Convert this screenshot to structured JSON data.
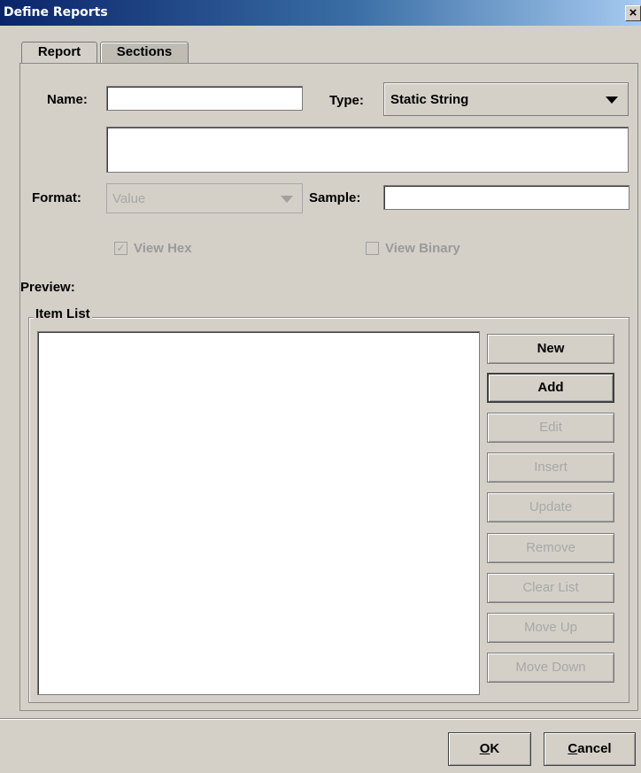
{
  "window": {
    "title": "Define Reports",
    "close_glyph": "×"
  },
  "tabs": [
    {
      "label": "Report",
      "active": true
    },
    {
      "label": "Sections",
      "active": false
    }
  ],
  "form": {
    "name_label": "Name:",
    "name_value": "",
    "type_label": "Type:",
    "type_value": "Static String",
    "text_value": "",
    "format_label": "Format:",
    "format_value": "Value",
    "sample_label": "Sample:",
    "sample_value": "",
    "view_hex_label": "View Hex",
    "view_hex_checked": true,
    "view_binary_label": "View Binary",
    "view_binary_checked": false,
    "preview_label": "Preview:"
  },
  "item_list": {
    "title": "Item List",
    "items": [],
    "buttons": [
      {
        "label": "New",
        "enabled": true
      },
      {
        "label": "Add",
        "enabled": true
      },
      {
        "label": "Edit",
        "enabled": false
      },
      {
        "label": "Insert",
        "enabled": false
      },
      {
        "label": "Update",
        "enabled": false
      },
      {
        "label": "Remove",
        "enabled": false
      },
      {
        "label": "Clear List",
        "enabled": false
      },
      {
        "label": "Move Up",
        "enabled": false
      },
      {
        "label": "Move Down",
        "enabled": false
      }
    ]
  },
  "dialog_buttons": {
    "ok_mnemonic": "O",
    "ok_rest": "K",
    "cancel_mnemonic": "C",
    "cancel_rest": "ancel"
  },
  "icons": {
    "dropdown": "chevron-down-icon",
    "check": "checkmark-icon"
  }
}
